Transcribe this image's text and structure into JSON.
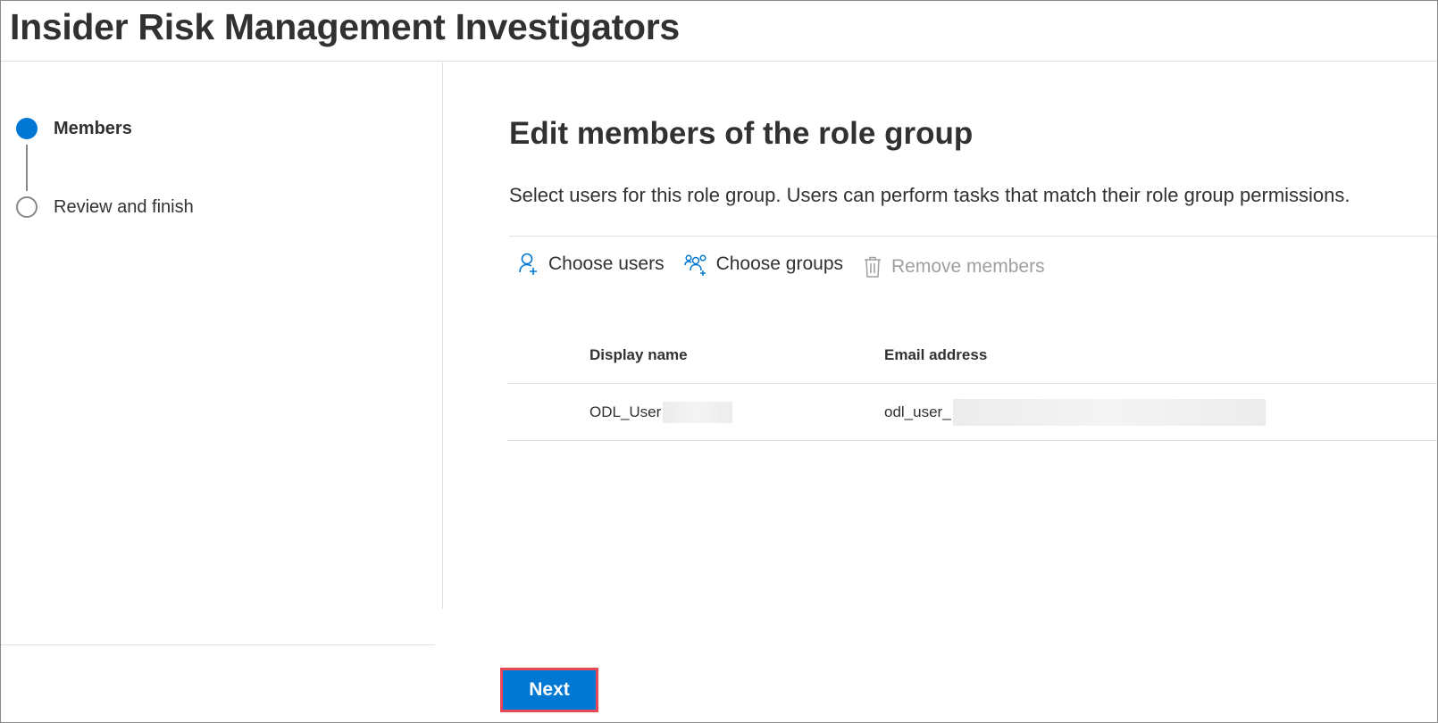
{
  "header": {
    "title": "Insider Risk Management Investigators"
  },
  "steps": [
    {
      "label": "Members",
      "state": "active"
    },
    {
      "label": "Review and finish",
      "state": "pending"
    }
  ],
  "main": {
    "heading": "Edit members of the role group",
    "description": "Select users for this role group. Users can perform tasks that match their role group permissions."
  },
  "toolbar": {
    "choose_users": {
      "label": "Choose users",
      "icon": "add-person-icon"
    },
    "choose_groups": {
      "label": "Choose groups",
      "icon": "people-group-icon"
    },
    "remove_members": {
      "label": "Remove members",
      "icon": "trash-icon",
      "disabled": true
    }
  },
  "table": {
    "headers": {
      "display_name": "Display name",
      "email": "Email address"
    },
    "rows": [
      {
        "display_name": "ODL_User",
        "email": "odl_user_"
      }
    ]
  },
  "footer": {
    "next_label": "Next"
  },
  "colors": {
    "accent": "#0078d4",
    "highlight_border": "#e74856"
  }
}
